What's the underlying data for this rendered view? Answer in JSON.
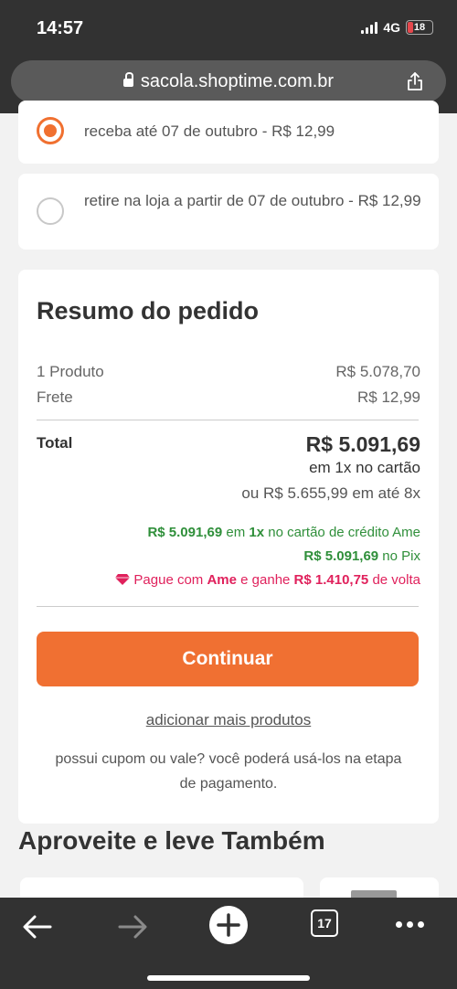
{
  "status_bar": {
    "time": "14:57",
    "network": "4G",
    "battery_level": "18"
  },
  "browser": {
    "url": "sacola.shoptime.com.br",
    "open_tabs": "17"
  },
  "delivery_options": [
    {
      "label": "receba até 07 de outubro - R$ 12,99",
      "selected": true
    },
    {
      "label": "retire na loja a partir de 07 de outubro - R$ 12,99",
      "selected": false
    }
  ],
  "summary": {
    "title": "Resumo do pedido",
    "products_label": "1 Produto",
    "products_value": "R$ 5.078,70",
    "shipping_label": "Frete",
    "shipping_value": "R$ 12,99",
    "total_label": "Total",
    "total_value": "R$ 5.091,69",
    "installment_line": "em 1x no cartão",
    "alt_installment_line": "ou R$ 5.655,99 em até 8x",
    "ame_card": {
      "amount": "R$ 5.091,69",
      "text1": " em ",
      "times": "1x",
      "text2": " no cartão de crédito Ame"
    },
    "pix": {
      "amount": "R$ 5.091,69",
      "text": " no Pix"
    },
    "cashback": {
      "text1": "Pague com ",
      "brand": "Ame",
      "text2": " e ganhe ",
      "amount": "R$ 1.410,75",
      "text3": " de volta"
    },
    "continue_label": "Continuar",
    "add_more_label": "adicionar mais produtos",
    "coupon_note": "possui cupom ou vale? você poderá usá-los na etapa de pagamento."
  },
  "also_buy": {
    "title": "Aproveite e leve Também"
  },
  "colors": {
    "accent": "#f07032",
    "green": "#2f8f3a",
    "pink": "#e0215c",
    "browser_chrome": "#323232"
  }
}
